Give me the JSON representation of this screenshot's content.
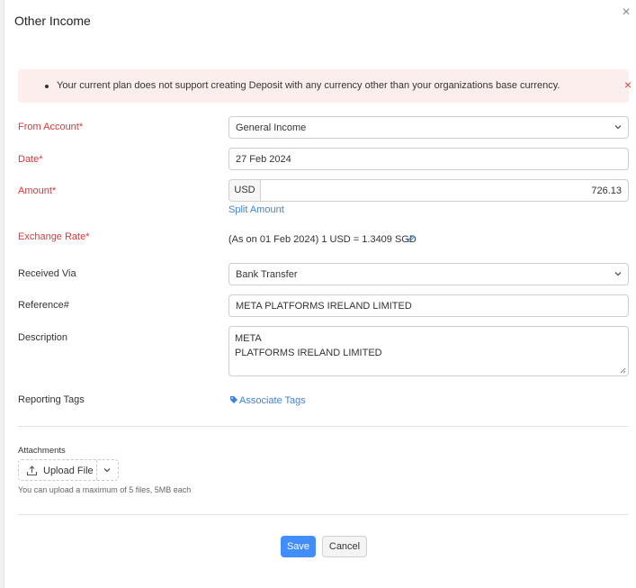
{
  "modal": {
    "title": "Other Income",
    "close_symbol": "×"
  },
  "alert": {
    "message": "Your current plan does not support creating Deposit with any currency other than your organizations base currency.",
    "dismiss_symbol": "×"
  },
  "form": {
    "from_account": {
      "label": "From Account*",
      "value": "General Income"
    },
    "date": {
      "label": "Date*",
      "value": "27 Feb 2024"
    },
    "amount": {
      "label": "Amount*",
      "currency": "USD",
      "value": "726.13",
      "split_link": "Split Amount"
    },
    "exchange_rate": {
      "label": "Exchange Rate*",
      "text": "(As on 01 Feb 2024)  1 USD = 1.3409 SGD"
    },
    "received_via": {
      "label": "Received Via",
      "value": "Bank Transfer"
    },
    "reference": {
      "label": "Reference#",
      "value": "META PLATFORMS IRELAND LIMITED"
    },
    "description": {
      "label": "Description",
      "line1": "META",
      "line2": "PLATFORMS IRELAND LIMITED"
    },
    "reporting_tags": {
      "label": "Reporting Tags",
      "link": "Associate Tags"
    }
  },
  "attachments": {
    "label": "Attachments",
    "upload_label": "Upload File",
    "hint": "You can upload a maximum of 5 files, 5MB each"
  },
  "actions": {
    "save": "Save",
    "cancel": "Cancel"
  },
  "colors": {
    "accent": "#408dfb",
    "link": "#4183d7",
    "required": "#d6393b",
    "alert_bg": "#fdeeee",
    "alert_x": "#e23c3c"
  },
  "icons": [
    "close-icon",
    "dismiss-alert-icon",
    "chevron-down-icon",
    "pencil-icon",
    "tag-icon",
    "upload-icon",
    "resize-handle-icon"
  ]
}
